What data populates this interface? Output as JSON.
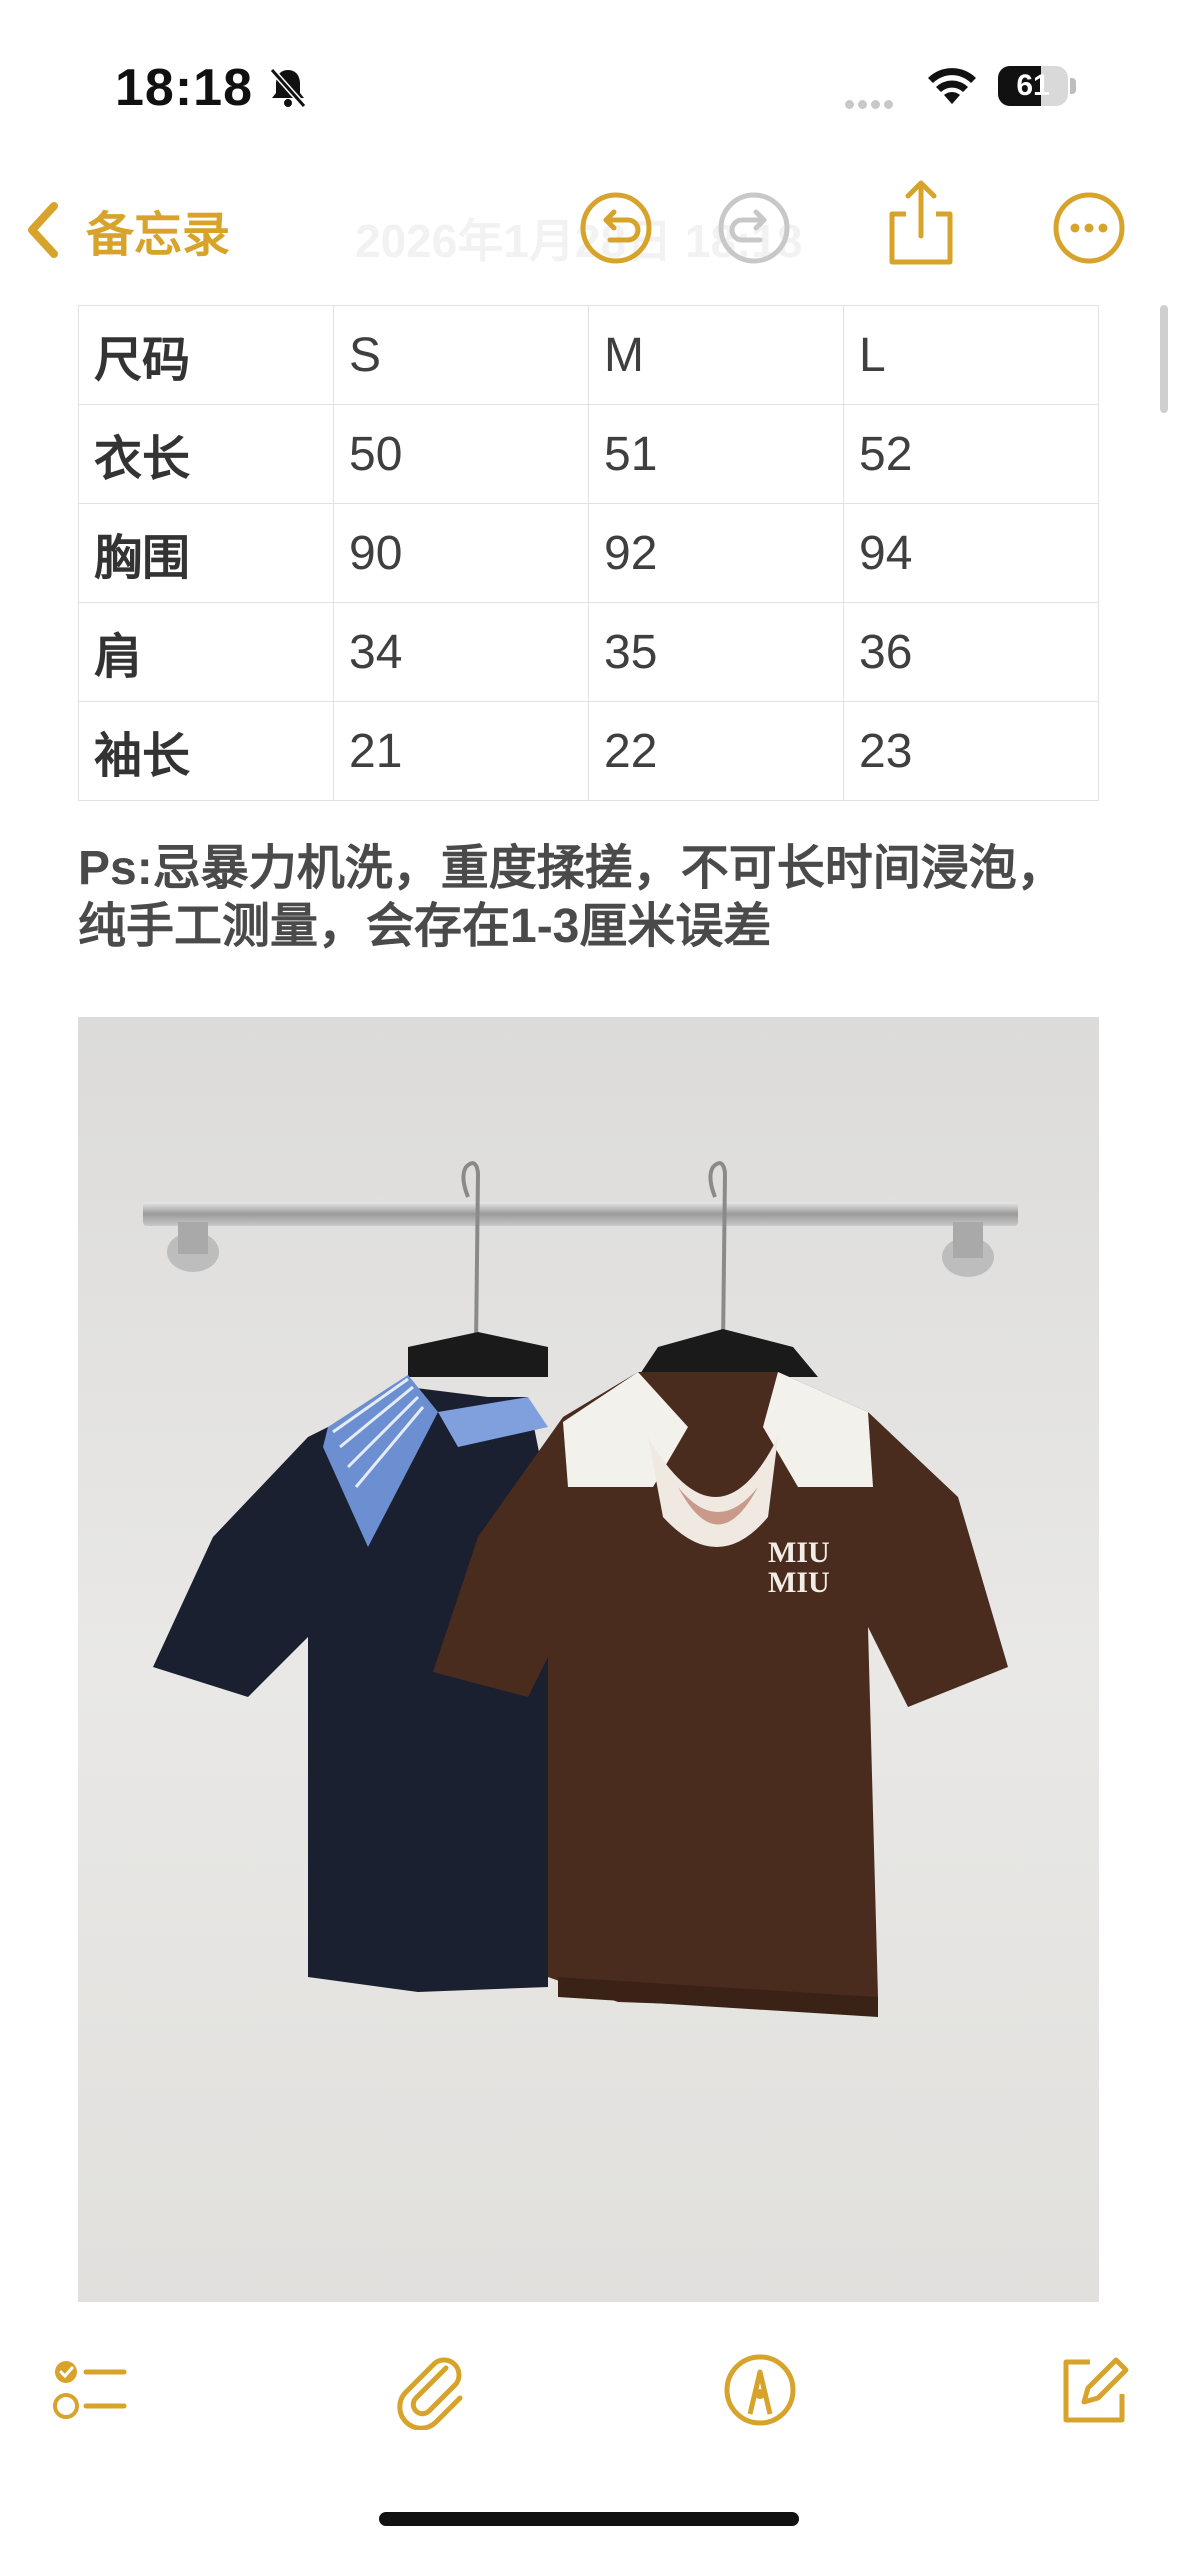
{
  "status_bar": {
    "time": "18:18",
    "battery_percent": "61",
    "battery_level": 0.61,
    "icons": [
      "bell-slash-icon",
      "cellular-dots-icon",
      "wifi-icon",
      "battery-icon"
    ]
  },
  "nav": {
    "back_label": "备忘录",
    "ghost_title": "2026年1月28日 18:18",
    "icons": [
      "chevron-left-icon",
      "undo-icon",
      "redo-icon",
      "share-icon",
      "more-icon"
    ]
  },
  "size_table": {
    "rows": [
      [
        "尺码",
        "S",
        "M",
        "L"
      ],
      [
        "衣长",
        "50",
        "51",
        "52"
      ],
      [
        "胸围",
        "90",
        "92",
        "94"
      ],
      [
        "肩",
        "34",
        "35",
        "36"
      ],
      [
        "袖长",
        "21",
        "22",
        "23"
      ]
    ]
  },
  "note": {
    "line1": "Ps:忌暴力机洗，重度揉搓，不可长时间浸泡，",
    "line2": "纯手工测量，会存在1-3厘米误差"
  },
  "photo": {
    "logo_line1": "MIU",
    "logo_line2": "MIU"
  },
  "toolbar": {
    "icons": [
      "checklist-icon",
      "paperclip-icon",
      "markup-pen-icon",
      "compose-icon"
    ]
  },
  "colors": {
    "accent": "#d7a32a",
    "navy_shirt": "#1b2030",
    "brown_shirt": "#4a2c1f"
  }
}
